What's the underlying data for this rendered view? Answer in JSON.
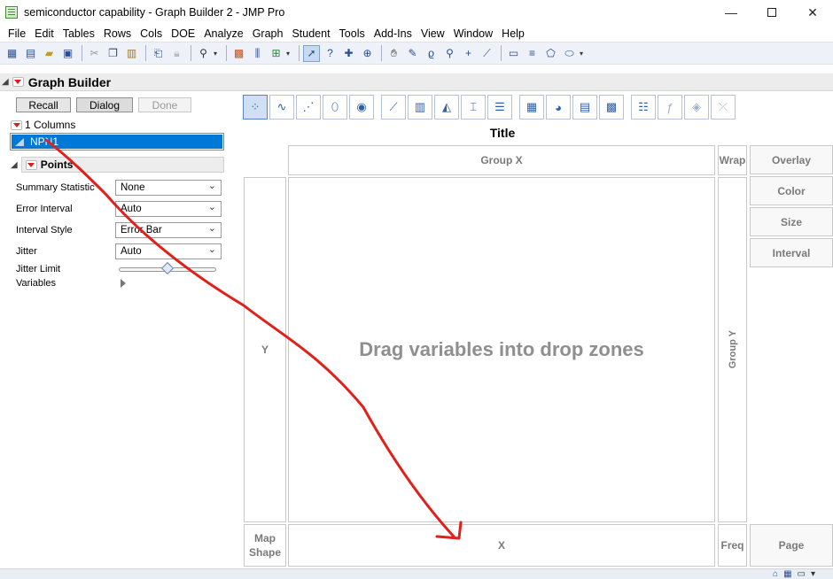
{
  "window": {
    "title": "semiconductor capability - Graph Builder 2 - JMP Pro",
    "controls": [
      "minimize",
      "maximize",
      "close"
    ]
  },
  "menu": [
    "File",
    "Edit",
    "Tables",
    "Rows",
    "Cols",
    "DOE",
    "Analyze",
    "Graph",
    "Student",
    "Tools",
    "Add-Ins",
    "View",
    "Window",
    "Help"
  ],
  "graph_builder": {
    "title": "Graph Builder",
    "buttons": {
      "recall": "Recall",
      "dialog": "Dialog",
      "done": "Done"
    },
    "columns_label": "1 Columns",
    "columns": [
      {
        "name": "NPN1",
        "selected": true
      }
    ],
    "points": {
      "title": "Points",
      "options": [
        {
          "label": "Summary Statistic",
          "value": "None"
        },
        {
          "label": "Error Interval",
          "value": "Auto"
        },
        {
          "label": "Interval Style",
          "value": "Error Bar"
        },
        {
          "label": "Jitter",
          "value": "Auto"
        }
      ],
      "jitter_limit_label": "Jitter Limit",
      "jitter_limit": 0.5,
      "variables_label": "Variables"
    }
  },
  "chart": {
    "title": "Title",
    "zones": {
      "group_x": "Group X",
      "wrap": "Wrap",
      "overlay": "Overlay",
      "color": "Color",
      "size": "Size",
      "interval": "Interval",
      "y": "Y",
      "group_y": "Group Y",
      "map_shape": "Map Shape",
      "x": "X",
      "freq": "Freq",
      "page": "Page"
    },
    "drag_message": "Drag variables into drop zones",
    "element_icons": [
      "points",
      "smoother",
      "line-of-fit",
      "ellipse",
      "contour",
      "line",
      "bar",
      "area",
      "box-plot",
      "histogram",
      "heatmap",
      "pie",
      "treemap",
      "mosaic",
      "caption-box",
      "formula",
      "map-shapes",
      "parallel"
    ]
  },
  "annotation": {
    "color": "#e0201a",
    "description": "arrow from NPN1 to X zone"
  }
}
